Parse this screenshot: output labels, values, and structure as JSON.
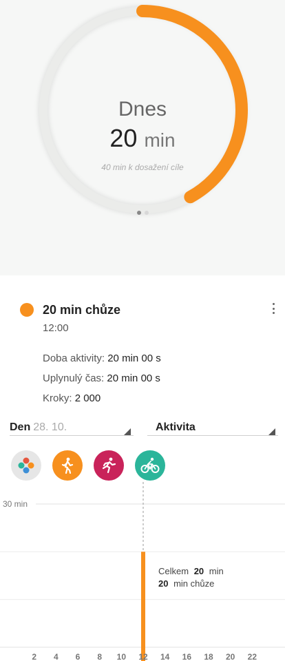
{
  "ring": {
    "label": "Dnes",
    "value": "20",
    "unit": "min",
    "goal_text": "40 min k dosažení cíle",
    "progress_fraction": 0.42,
    "color": "#f7901e",
    "pager_pages": 2,
    "pager_active": 0
  },
  "activity": {
    "title": "20 min chůze",
    "time": "12:00",
    "duration_label": "Doba aktivity:",
    "duration_value": "20 min 00 s",
    "elapsed_label": "Uplynulý čas:",
    "elapsed_value": "20 min 00 s",
    "steps_label": "Kroky:",
    "steps_value": "2 000",
    "color": "#f7901e"
  },
  "filters": {
    "period_label": "Den",
    "period_date": "28. 10.",
    "type_label": "Aktivita"
  },
  "chips": [
    {
      "name": "all-activities-icon",
      "bg": "#e6e6e6"
    },
    {
      "name": "walking-icon",
      "bg": "#f7901e"
    },
    {
      "name": "running-icon",
      "bg": "#c9235a"
    },
    {
      "name": "cycling-icon",
      "bg": "#2bb59a"
    }
  ],
  "chart_data": {
    "type": "bar",
    "y_max_label": "30 min",
    "ylim": [
      0,
      30
    ],
    "x_ticks": [
      "2",
      "4",
      "6",
      "8",
      "10",
      "12",
      "14",
      "16",
      "18",
      "20",
      "22"
    ],
    "xlim": [
      0,
      24
    ],
    "bars": [
      {
        "x": 12,
        "value": 20,
        "color": "#f7901e"
      }
    ],
    "tooltip": {
      "total_prefix": "Celkem",
      "total_value": "20",
      "total_unit": "min",
      "line2_value": "20",
      "line2_text": "min chůze"
    }
  }
}
